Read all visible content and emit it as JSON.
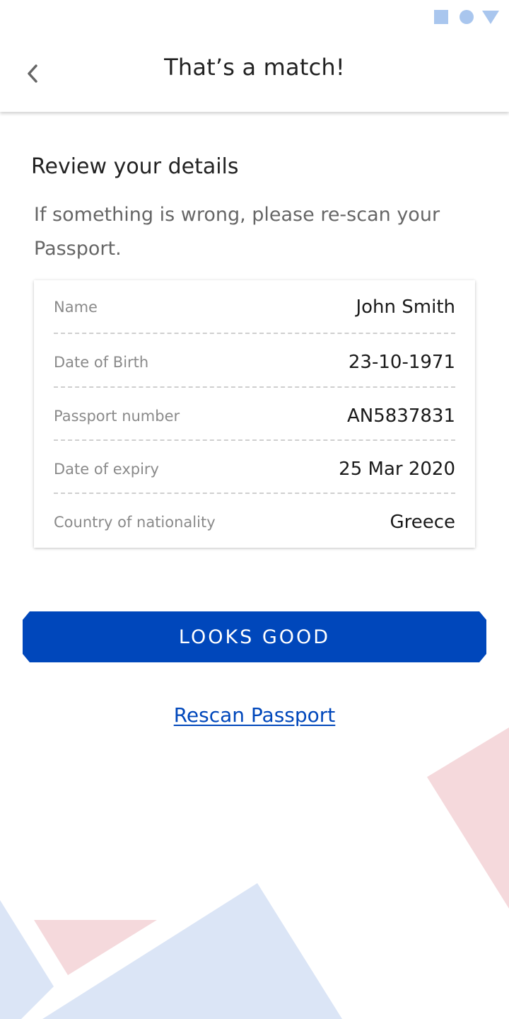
{
  "header": {
    "title": "That’s a match!",
    "back_icon": "chevron-left-icon"
  },
  "status_bar": {
    "icons": [
      "square-icon",
      "circle-icon",
      "triangle-icon"
    ]
  },
  "review": {
    "title": "Review your details",
    "subtitle": "If something is wrong, please re-scan your Passport."
  },
  "details": [
    {
      "label": "Name",
      "value": "John Smith"
    },
    {
      "label": "Date of Birth",
      "value": "23-10-1971"
    },
    {
      "label": "Passport number",
      "value": "AN5837831"
    },
    {
      "label": "Date of expiry",
      "value": "25 Mar 2020"
    },
    {
      "label": "Country of nationality",
      "value": "Greece"
    }
  ],
  "actions": {
    "confirm_label": "LOOKS GOOD",
    "rescan_label": "Rescan Passport"
  },
  "colors": {
    "primary": "#0047bb",
    "status_icons": "#a9c6ee",
    "decor_blue": "#dbe5f6",
    "decor_red": "#f5d9dc"
  }
}
